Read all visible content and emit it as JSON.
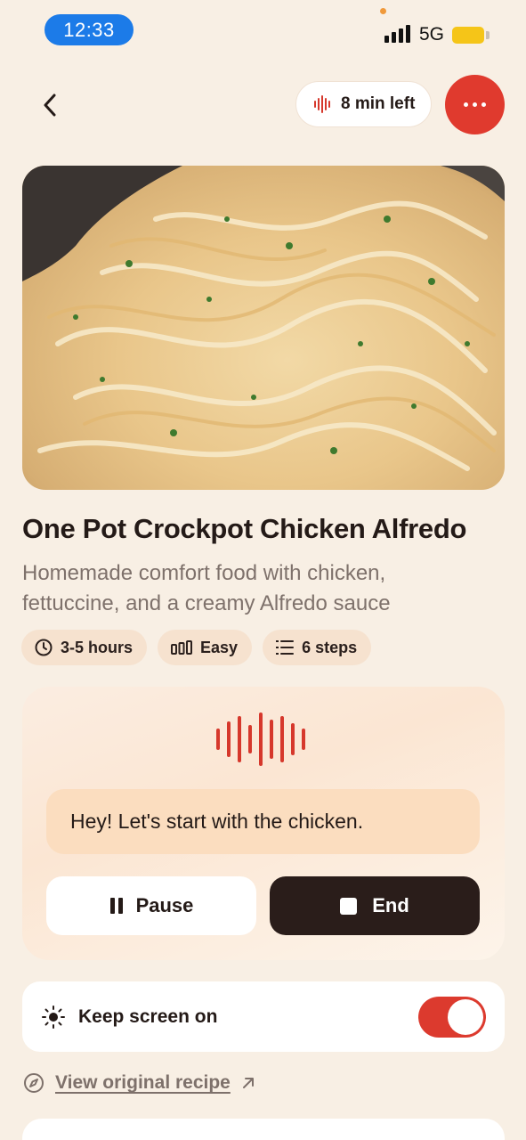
{
  "status_bar": {
    "time": "12:33",
    "network": "5G",
    "icons": [
      "signal-icon",
      "battery-icon"
    ]
  },
  "header": {
    "back_icon": "chevron-left-icon",
    "time_left": "8 min left",
    "time_left_icon": "audio-wave-icon",
    "more_icon": "more-dots-icon"
  },
  "recipe": {
    "title": "One Pot Crockpot Chicken Alfredo",
    "description": "Homemade comfort food with chicken, fettuccine, and a creamy Alfredo sauce",
    "chips": [
      {
        "icon": "clock-icon",
        "label": "3-5 hours"
      },
      {
        "icon": "bars-icon",
        "label": "Easy"
      },
      {
        "icon": "list-icon",
        "label": "6 steps"
      }
    ]
  },
  "voice": {
    "message": "Hey! Let's start with the chicken.",
    "pause_label": "Pause",
    "end_label": "End"
  },
  "settings": {
    "keep_screen_on_label": "Keep screen on",
    "keep_screen_on": true
  },
  "link": {
    "label": "View original recipe"
  },
  "colors": {
    "background": "#F8EFE4",
    "accent": "#E03A2E",
    "dark": "#2A1D1A",
    "chip": "#F6E2CF"
  }
}
